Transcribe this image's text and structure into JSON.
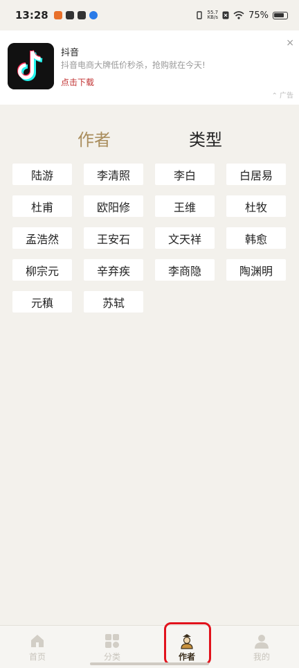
{
  "status": {
    "time": "13:28",
    "speed_value": "55.7",
    "speed_unit": "KB/s",
    "battery": "75%"
  },
  "ad": {
    "title": "抖音",
    "description": "抖音电商大牌低价秒杀，抢购就在今天!",
    "cta": "点击下载",
    "close": "×",
    "label": "广告"
  },
  "tabs": {
    "author": "作者",
    "type": "类型"
  },
  "authors": [
    "陆游",
    "李清照",
    "李白",
    "白居易",
    "杜甫",
    "欧阳修",
    "王维",
    "杜牧",
    "孟浩然",
    "王安石",
    "文天祥",
    "韩愈",
    "柳宗元",
    "辛弃疾",
    "李商隐",
    "陶渊明",
    "元稹",
    "苏轼"
  ],
  "nav": {
    "home": "首页",
    "category": "分类",
    "author": "作者",
    "mine": "我的"
  },
  "colors": {
    "accent": "#a98d5c",
    "highlight": "#e1121c",
    "ad_cta": "#c03030"
  }
}
